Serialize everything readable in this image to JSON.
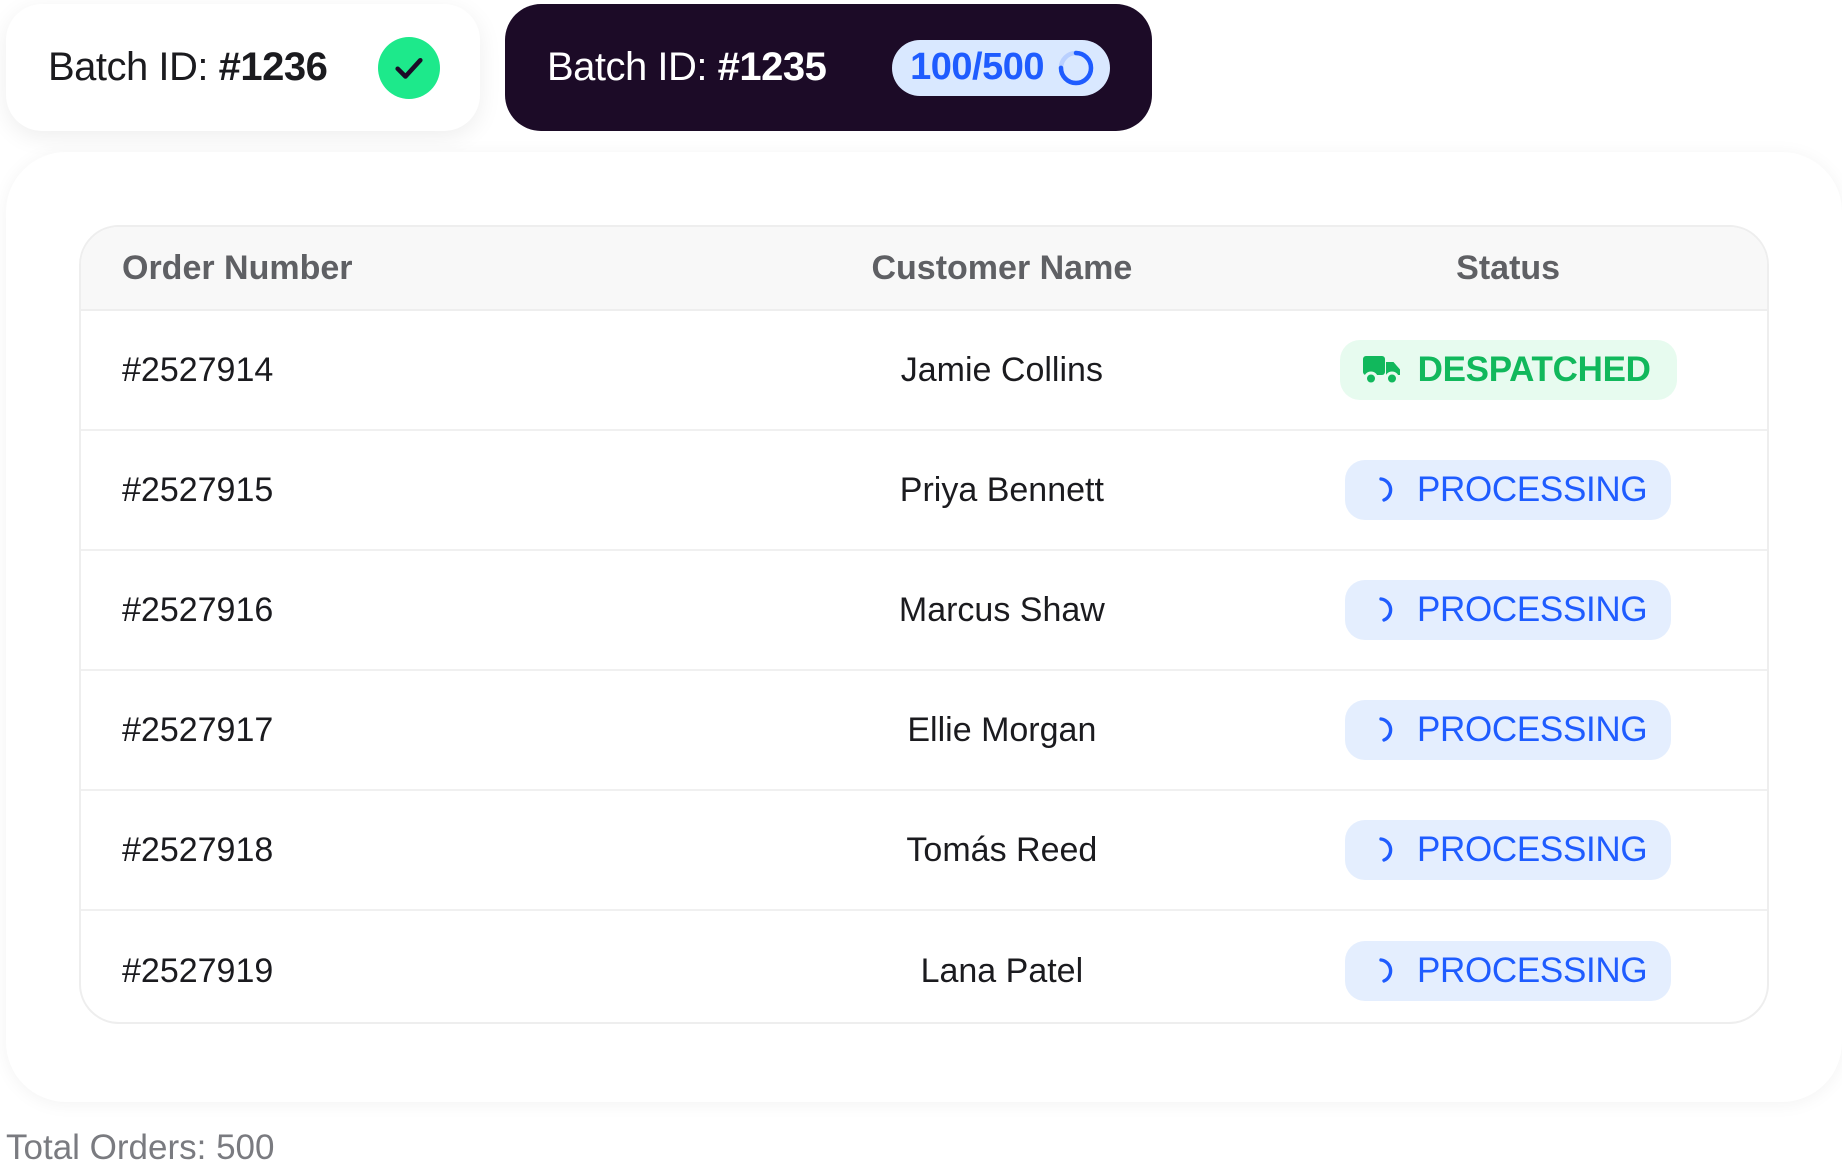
{
  "batches": [
    {
      "label": "Batch ID: ",
      "id": "#1236",
      "state": "complete",
      "icon": "check-icon"
    },
    {
      "label": "Batch ID: ",
      "id": "#1235",
      "state": "in-progress",
      "progress_text": "100/500",
      "progress_fraction": 0.2,
      "icon": "spinner-icon"
    }
  ],
  "table": {
    "columns": [
      "Order Number",
      "Customer Name",
      "Status"
    ],
    "rows": [
      {
        "order": "#2527914",
        "customer": "Jamie Collins",
        "status": "DESPATCHED"
      },
      {
        "order": "#2527915",
        "customer": "Priya Bennett",
        "status": "PROCESSING"
      },
      {
        "order": "#2527916",
        "customer": "Marcus Shaw",
        "status": "PROCESSING"
      },
      {
        "order": "#2527917",
        "customer": "Ellie Morgan",
        "status": "PROCESSING"
      },
      {
        "order": "#2527918",
        "customer": "Tomás Reed",
        "status": "PROCESSING"
      },
      {
        "order": "#2527919",
        "customer": "Lana Patel",
        "status": "PROCESSING"
      }
    ]
  },
  "status_icons": {
    "DESPATCHED": "truck-icon",
    "PROCESSING": "loading-arc-icon"
  },
  "colors": {
    "dark_tab": "#1c0b27",
    "success": "#1de98b",
    "despatched_text": "#11b85c",
    "despatched_bg": "#e7fbef",
    "processing_text": "#1f5cff",
    "processing_bg": "#e4eefe"
  },
  "footer": {
    "total_orders": "Total Orders: 500"
  }
}
